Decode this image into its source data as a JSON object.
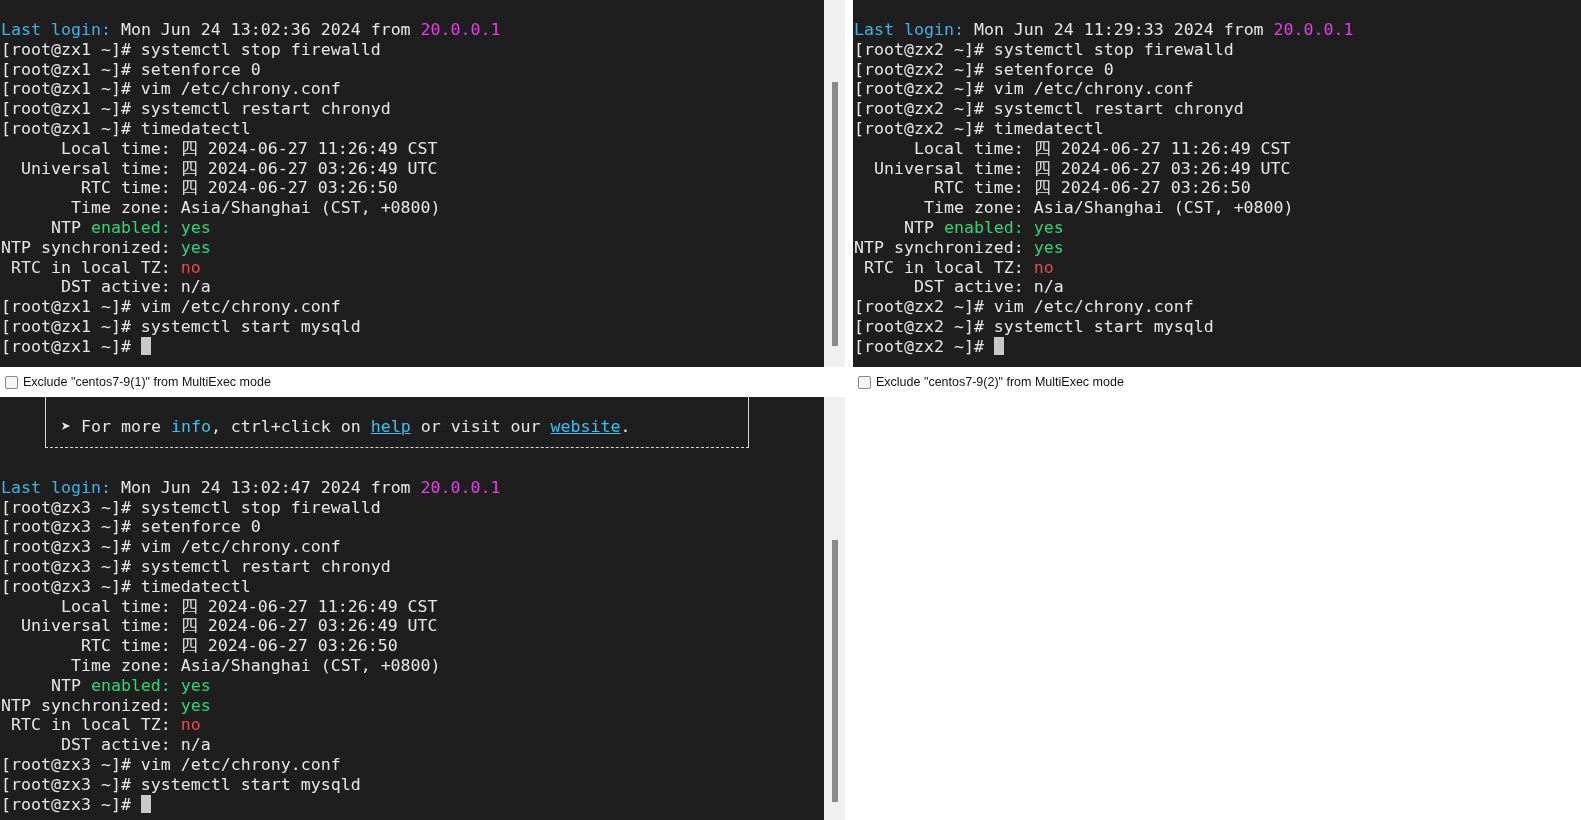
{
  "panes": [
    {
      "lines": [
        [
          {
            "text": "Last login:",
            "kind": "label"
          },
          {
            "text": " Mon Jun 24 13:02:36 2024 from ",
            "kind": "plain"
          },
          {
            "text": "20.0.0.1",
            "kind": "host"
          }
        ],
        [
          {
            "text": "[root@zx1 ~]# systemctl stop firewalld",
            "kind": "plain"
          }
        ],
        [
          {
            "text": "[root@zx1 ~]# setenforce 0",
            "kind": "plain"
          }
        ],
        [
          {
            "text": "[root@zx1 ~]# vim /etc/chrony.conf",
            "kind": "plain"
          }
        ],
        [
          {
            "text": "[root@zx1 ~]# systemctl restart chronyd",
            "kind": "plain"
          }
        ],
        [
          {
            "text": "[root@zx1 ~]# timedatectl",
            "kind": "plain"
          }
        ],
        [
          {
            "text": "      Local time: 四 2024-06-27 11:26:49 CST",
            "kind": "plain"
          }
        ],
        [
          {
            "text": "  Universal time: 四 2024-06-27 03:26:49 UTC",
            "kind": "plain"
          }
        ],
        [
          {
            "text": "        RTC time: 四 2024-06-27 03:26:50",
            "kind": "plain"
          }
        ],
        [
          {
            "text": "       Time zone: Asia/Shanghai (CST, +0800)",
            "kind": "plain"
          }
        ],
        [
          {
            "text": "     NTP ",
            "kind": "plain"
          },
          {
            "text": "enabled: yes",
            "kind": "good"
          }
        ],
        [
          {
            "text": "NTP synchronized: ",
            "kind": "plain"
          },
          {
            "text": "yes",
            "kind": "good"
          }
        ],
        [
          {
            "text": " RTC in local TZ: ",
            "kind": "plain"
          },
          {
            "text": "no",
            "kind": "bad"
          }
        ],
        [
          {
            "text": "      DST active: n/a",
            "kind": "plain"
          }
        ],
        [
          {
            "text": "[root@zx1 ~]# vim /etc/chrony.conf",
            "kind": "plain"
          }
        ],
        [
          {
            "text": "[root@zx1 ~]# systemctl start mysqld",
            "kind": "plain"
          }
        ],
        [
          {
            "text": "[root@zx1 ~]# ",
            "kind": "plain"
          }
        ]
      ],
      "cursor": true,
      "scrollbar": true,
      "exclude": {
        "label": "Exclude \"centos7-9(1)\" from MultiExec mode",
        "checked": false
      }
    },
    {
      "lines": [
        [
          {
            "text": "Last login:",
            "kind": "label"
          },
          {
            "text": " Mon Jun 24 11:29:33 2024 from ",
            "kind": "plain"
          },
          {
            "text": "20.0.0.1",
            "kind": "host"
          }
        ],
        [
          {
            "text": "[root@zx2 ~]# systemctl stop firewalld",
            "kind": "plain"
          }
        ],
        [
          {
            "text": "[root@zx2 ~]# setenforce 0",
            "kind": "plain"
          }
        ],
        [
          {
            "text": "[root@zx2 ~]# vim /etc/chrony.conf",
            "kind": "plain"
          }
        ],
        [
          {
            "text": "[root@zx2 ~]# systemctl restart chronyd",
            "kind": "plain"
          }
        ],
        [
          {
            "text": "[root@zx2 ~]# timedatectl",
            "kind": "plain"
          }
        ],
        [
          {
            "text": "      Local time: 四 2024-06-27 11:26:49 CST",
            "kind": "plain"
          }
        ],
        [
          {
            "text": "  Universal time: 四 2024-06-27 03:26:49 UTC",
            "kind": "plain"
          }
        ],
        [
          {
            "text": "        RTC time: 四 2024-06-27 03:26:50",
            "kind": "plain"
          }
        ],
        [
          {
            "text": "       Time zone: Asia/Shanghai (CST, +0800)",
            "kind": "plain"
          }
        ],
        [
          {
            "text": "     NTP ",
            "kind": "plain"
          },
          {
            "text": "enabled: yes",
            "kind": "good"
          }
        ],
        [
          {
            "text": "NTP synchronized: ",
            "kind": "plain"
          },
          {
            "text": "yes",
            "kind": "good"
          }
        ],
        [
          {
            "text": " RTC in local TZ: ",
            "kind": "plain"
          },
          {
            "text": "no",
            "kind": "bad"
          }
        ],
        [
          {
            "text": "      DST active: n/a",
            "kind": "plain"
          }
        ],
        [
          {
            "text": "[root@zx2 ~]# vim /etc/chrony.conf",
            "kind": "plain"
          }
        ],
        [
          {
            "text": "[root@zx2 ~]# systemctl start mysqld",
            "kind": "plain"
          }
        ],
        [
          {
            "text": "[root@zx2 ~]# ",
            "kind": "plain"
          }
        ]
      ],
      "cursor": true,
      "exclude": {
        "label": "Exclude \"centos7-9(2)\" from MultiExec mode",
        "checked": false
      }
    },
    {
      "info": [
        {
          "text": "➤ For more ",
          "kind": "plain"
        },
        {
          "text": "info",
          "kind": "accent"
        },
        {
          "text": ", ctrl+click on ",
          "kind": "plain"
        },
        {
          "text": "help",
          "kind": "link"
        },
        {
          "text": " or visit our ",
          "kind": "plain"
        },
        {
          "text": "website",
          "kind": "link"
        },
        {
          "text": ".",
          "kind": "plain"
        }
      ],
      "lines": [
        [
          {
            "text": "Last login:",
            "kind": "label"
          },
          {
            "text": " Mon Jun 24 13:02:47 2024 from ",
            "kind": "plain"
          },
          {
            "text": "20.0.0.1",
            "kind": "host"
          }
        ],
        [
          {
            "text": "[root@zx3 ~]# systemctl stop firewalld",
            "kind": "plain"
          }
        ],
        [
          {
            "text": "[root@zx3 ~]# setenforce 0",
            "kind": "plain"
          }
        ],
        [
          {
            "text": "[root@zx3 ~]# vim /etc/chrony.conf",
            "kind": "plain"
          }
        ],
        [
          {
            "text": "[root@zx3 ~]# systemctl restart chronyd",
            "kind": "plain"
          }
        ],
        [
          {
            "text": "[root@zx3 ~]# timedatectl",
            "kind": "plain"
          }
        ],
        [
          {
            "text": "      Local time: 四 2024-06-27 11:26:49 CST",
            "kind": "plain"
          }
        ],
        [
          {
            "text": "  Universal time: 四 2024-06-27 03:26:49 UTC",
            "kind": "plain"
          }
        ],
        [
          {
            "text": "        RTC time: 四 2024-06-27 03:26:50",
            "kind": "plain"
          }
        ],
        [
          {
            "text": "       Time zone: Asia/Shanghai (CST, +0800)",
            "kind": "plain"
          }
        ],
        [
          {
            "text": "     NTP ",
            "kind": "plain"
          },
          {
            "text": "enabled: yes",
            "kind": "good"
          }
        ],
        [
          {
            "text": "NTP synchronized: ",
            "kind": "plain"
          },
          {
            "text": "yes",
            "kind": "good"
          }
        ],
        [
          {
            "text": " RTC in local TZ: ",
            "kind": "plain"
          },
          {
            "text": "no",
            "kind": "bad"
          }
        ],
        [
          {
            "text": "      DST active: n/a",
            "kind": "plain"
          }
        ],
        [
          {
            "text": "[root@zx3 ~]# vim /etc/chrony.conf",
            "kind": "plain"
          }
        ],
        [
          {
            "text": "[root@zx3 ~]# systemctl start mysqld",
            "kind": "plain"
          }
        ],
        [
          {
            "text": "[root@zx3 ~]# ",
            "kind": "plain"
          }
        ]
      ],
      "cursor": true,
      "scrollbar": true
    }
  ]
}
